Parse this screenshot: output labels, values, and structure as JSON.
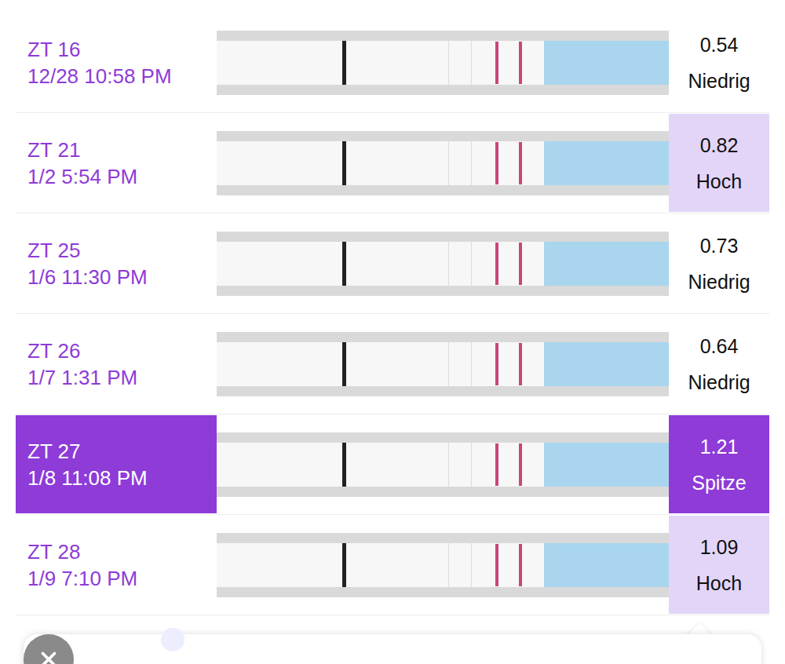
{
  "tests": [
    {
      "cycle_day": "ZT 16",
      "datetime": "12/28 10:58 PM",
      "ratio": "0.54",
      "result": "Niedrig",
      "kind": "low",
      "selected": false
    },
    {
      "cycle_day": "ZT 21",
      "datetime": "1/2 5:54 PM",
      "ratio": "0.82",
      "result": "Hoch",
      "kind": "high",
      "selected": false
    },
    {
      "cycle_day": "ZT 25",
      "datetime": "1/6 11:30 PM",
      "ratio": "0.73",
      "result": "Niedrig",
      "kind": "low",
      "selected": false
    },
    {
      "cycle_day": "ZT 26",
      "datetime": "1/7 1:31 PM",
      "ratio": "0.64",
      "result": "Niedrig",
      "kind": "low",
      "selected": false
    },
    {
      "cycle_day": "ZT 27",
      "datetime": "1/8 11:08 PM",
      "ratio": "1.21",
      "result": "Spitze",
      "kind": "peak",
      "selected": true
    },
    {
      "cycle_day": "ZT 28",
      "datetime": "1/9 7:10 PM",
      "ratio": "1.09",
      "result": "Hoch",
      "kind": "high",
      "selected": false
    }
  ]
}
